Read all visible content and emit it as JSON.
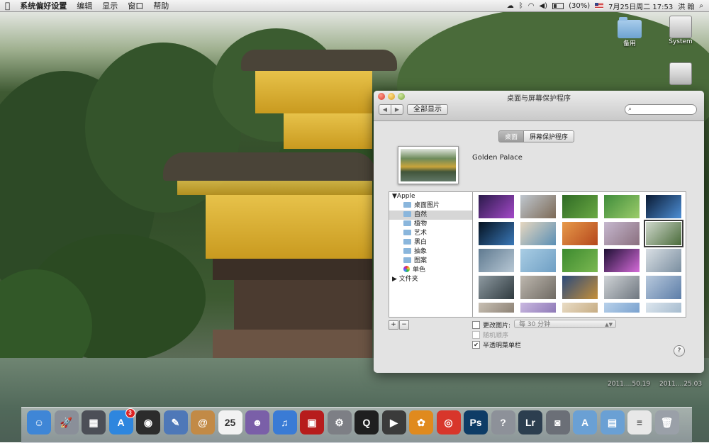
{
  "menubar": {
    "app_name": "系统偏好设置",
    "items": [
      "编辑",
      "显示",
      "窗口",
      "帮助"
    ],
    "battery": "(30%)",
    "clock": "7月25日周二  17:53",
    "user": "洪 翰"
  },
  "desktop": {
    "icons": [
      {
        "label": "备用"
      },
      {
        "label": "System"
      }
    ],
    "file_labels": [
      "2011....50.19",
      "2011....25.03"
    ]
  },
  "window": {
    "title": "桌面与屏幕保护程序",
    "show_all": "全部显示",
    "search_placeholder": "",
    "tabs": [
      {
        "label": "桌面",
        "active": true
      },
      {
        "label": "屏幕保护程序",
        "active": false
      }
    ],
    "current_picture": "Golden Palace",
    "sidebar": {
      "group": "Apple",
      "items": [
        {
          "label": "桌面图片",
          "icon": "folder-icon"
        },
        {
          "label": "自然",
          "icon": "folder-icon",
          "selected": true
        },
        {
          "label": "植物",
          "icon": "folder-icon"
        },
        {
          "label": "艺术",
          "icon": "folder-icon"
        },
        {
          "label": "黑白",
          "icon": "folder-icon"
        },
        {
          "label": "抽象",
          "icon": "folder-icon"
        },
        {
          "label": "图案",
          "icon": "folder-icon"
        },
        {
          "label": "单色",
          "icon": "color-wheel-icon"
        }
      ],
      "folders_group": "文件夹"
    },
    "add_btn": "+",
    "remove_btn": "−",
    "change_picture": {
      "label": "更改图片:",
      "checked": false
    },
    "interval": "每 30 分钟",
    "random_order": {
      "label": "随机顺序",
      "checked": false
    },
    "translucent_menubar": {
      "label": "半透明菜单栏",
      "checked": true
    },
    "help": "?"
  },
  "thumbnails": [
    {
      "name": "galaxy-thumbnail",
      "colors": [
        "#2a1a4a",
        "#a449c9"
      ]
    },
    {
      "name": "mountains-thumbnail",
      "colors": [
        "#bfc7cf",
        "#7d6a56"
      ]
    },
    {
      "name": "ladybug-leaf-thumbnail",
      "colors": [
        "#2f6b25",
        "#6aa843"
      ]
    },
    {
      "name": "green-drop-thumbnail",
      "colors": [
        "#3f8c3b",
        "#9ccc6a"
      ]
    },
    {
      "name": "earth-horizon-thumbnail",
      "colors": [
        "#0a1a33",
        "#4d8fd6"
      ]
    },
    {
      "name": "earth-globe-thumbnail",
      "colors": [
        "#04111f",
        "#3a78b8"
      ]
    },
    {
      "name": "coast-thumbnail",
      "colors": [
        "#e6d7c0",
        "#5a8fb5"
      ]
    },
    {
      "name": "orange-dunes-thumbnail",
      "colors": [
        "#e79a4a",
        "#b5471c"
      ]
    },
    {
      "name": "pink-dunes-thumbnail",
      "colors": [
        "#c6b8cf",
        "#8a6f7e"
      ]
    },
    {
      "name": "golden-palace-thumbnail",
      "colors": [
        "#cfd8cc",
        "#4a6b3a"
      ]
    },
    {
      "name": "blue-horizon-thumbnail",
      "colors": [
        "#5f7a90",
        "#b7c7d4"
      ]
    },
    {
      "name": "ice-thumbnail",
      "colors": [
        "#a9cde4",
        "#6f9fc4"
      ]
    },
    {
      "name": "ladybug-thumbnail",
      "colors": [
        "#3c8a2f",
        "#7bb851"
      ]
    },
    {
      "name": "aurora-thumbnail",
      "colors": [
        "#1d0f33",
        "#d56bd9"
      ]
    },
    {
      "name": "lake-thumbnail",
      "colors": [
        "#d9dfe4",
        "#7a8ea0"
      ]
    },
    {
      "name": "rocks-lake-thumbnail",
      "colors": [
        "#8e9aa1",
        "#2f3a3f"
      ]
    },
    {
      "name": "pebbles-thumbnail",
      "colors": [
        "#bdb7ae",
        "#6f6a63"
      ]
    },
    {
      "name": "leopard-thumbnail",
      "colors": [
        "#2b4a7b",
        "#c58f3a"
      ]
    },
    {
      "name": "snow-leopard-thumbnail",
      "colors": [
        "#cfd3d6",
        "#6f7780"
      ]
    },
    {
      "name": "blue-dunes-thumbnail",
      "colors": [
        "#b7c8dc",
        "#5d7ea8"
      ]
    },
    {
      "name": "stones-thumbnail",
      "colors": [
        "#c8c0b4",
        "#8d8275"
      ]
    },
    {
      "name": "purple-thumbnail",
      "colors": [
        "#c9b8e0",
        "#8f7ab8"
      ]
    },
    {
      "name": "sand-thumbnail",
      "colors": [
        "#e9dcc5",
        "#c7ad84"
      ]
    },
    {
      "name": "sky-thumbnail",
      "colors": [
        "#b8d1ea",
        "#7aa2cf"
      ]
    },
    {
      "name": "pale-sky-thumbnail",
      "colors": [
        "#dde6ee",
        "#a6bccf"
      ]
    }
  ],
  "dock": {
    "items": [
      {
        "name": "finder-icon",
        "glyph": "☺",
        "color": "#3f86d6"
      },
      {
        "name": "launchpad-icon",
        "glyph": "🚀",
        "color": "#8a8f99"
      },
      {
        "name": "mission-control-icon",
        "glyph": "▦",
        "color": "#4c4f57"
      },
      {
        "name": "app-store-icon",
        "glyph": "A",
        "color": "#2e86de",
        "badge": "3"
      },
      {
        "name": "dashboard-icon",
        "glyph": "◉",
        "color": "#2c2c2c"
      },
      {
        "name": "preview-icon",
        "glyph": "✎",
        "color": "#4e78b8"
      },
      {
        "name": "address-book-icon",
        "glyph": "@",
        "color": "#c28a46"
      },
      {
        "name": "ical-icon",
        "glyph": "25",
        "color": "#f2f2f2"
      },
      {
        "name": "photo-booth-icon",
        "glyph": "☻",
        "color": "#7a5fa8"
      },
      {
        "name": "itunes-icon",
        "glyph": "♫",
        "color": "#3a7bd5"
      },
      {
        "name": "photo-app-icon",
        "glyph": "▣",
        "color": "#b71c1c"
      },
      {
        "name": "system-preferences-icon",
        "glyph": "⚙",
        "color": "#7d7f85"
      },
      {
        "name": "qq-icon",
        "glyph": "Q",
        "color": "#1f1f1f"
      },
      {
        "name": "dvd-player-icon",
        "glyph": "▶",
        "color": "#3b3b3b"
      },
      {
        "name": "picasa-icon",
        "glyph": "✿",
        "color": "#e08a1e"
      },
      {
        "name": "chrome-icon",
        "glyph": "◎",
        "color": "#d8362b"
      },
      {
        "name": "photoshop-icon",
        "glyph": "Ps",
        "color": "#0e3c66"
      },
      {
        "name": "help-icon",
        "glyph": "?",
        "color": "#8d9199"
      },
      {
        "name": "lightroom-icon",
        "glyph": "Lr",
        "color": "#2c3e4f"
      },
      {
        "name": "facetime-icon",
        "glyph": "◙",
        "color": "#6b6f77"
      },
      {
        "name": "applications-folder-icon",
        "glyph": "A",
        "color": "#6aa0d4"
      },
      {
        "name": "documents-folder-icon",
        "glyph": "▤",
        "color": "#6aa0d4"
      },
      {
        "name": "document-icon",
        "glyph": "≡",
        "color": "#e8e8e8"
      },
      {
        "name": "trash-icon",
        "glyph": "🗑",
        "color": "#9aa0a8"
      }
    ]
  }
}
